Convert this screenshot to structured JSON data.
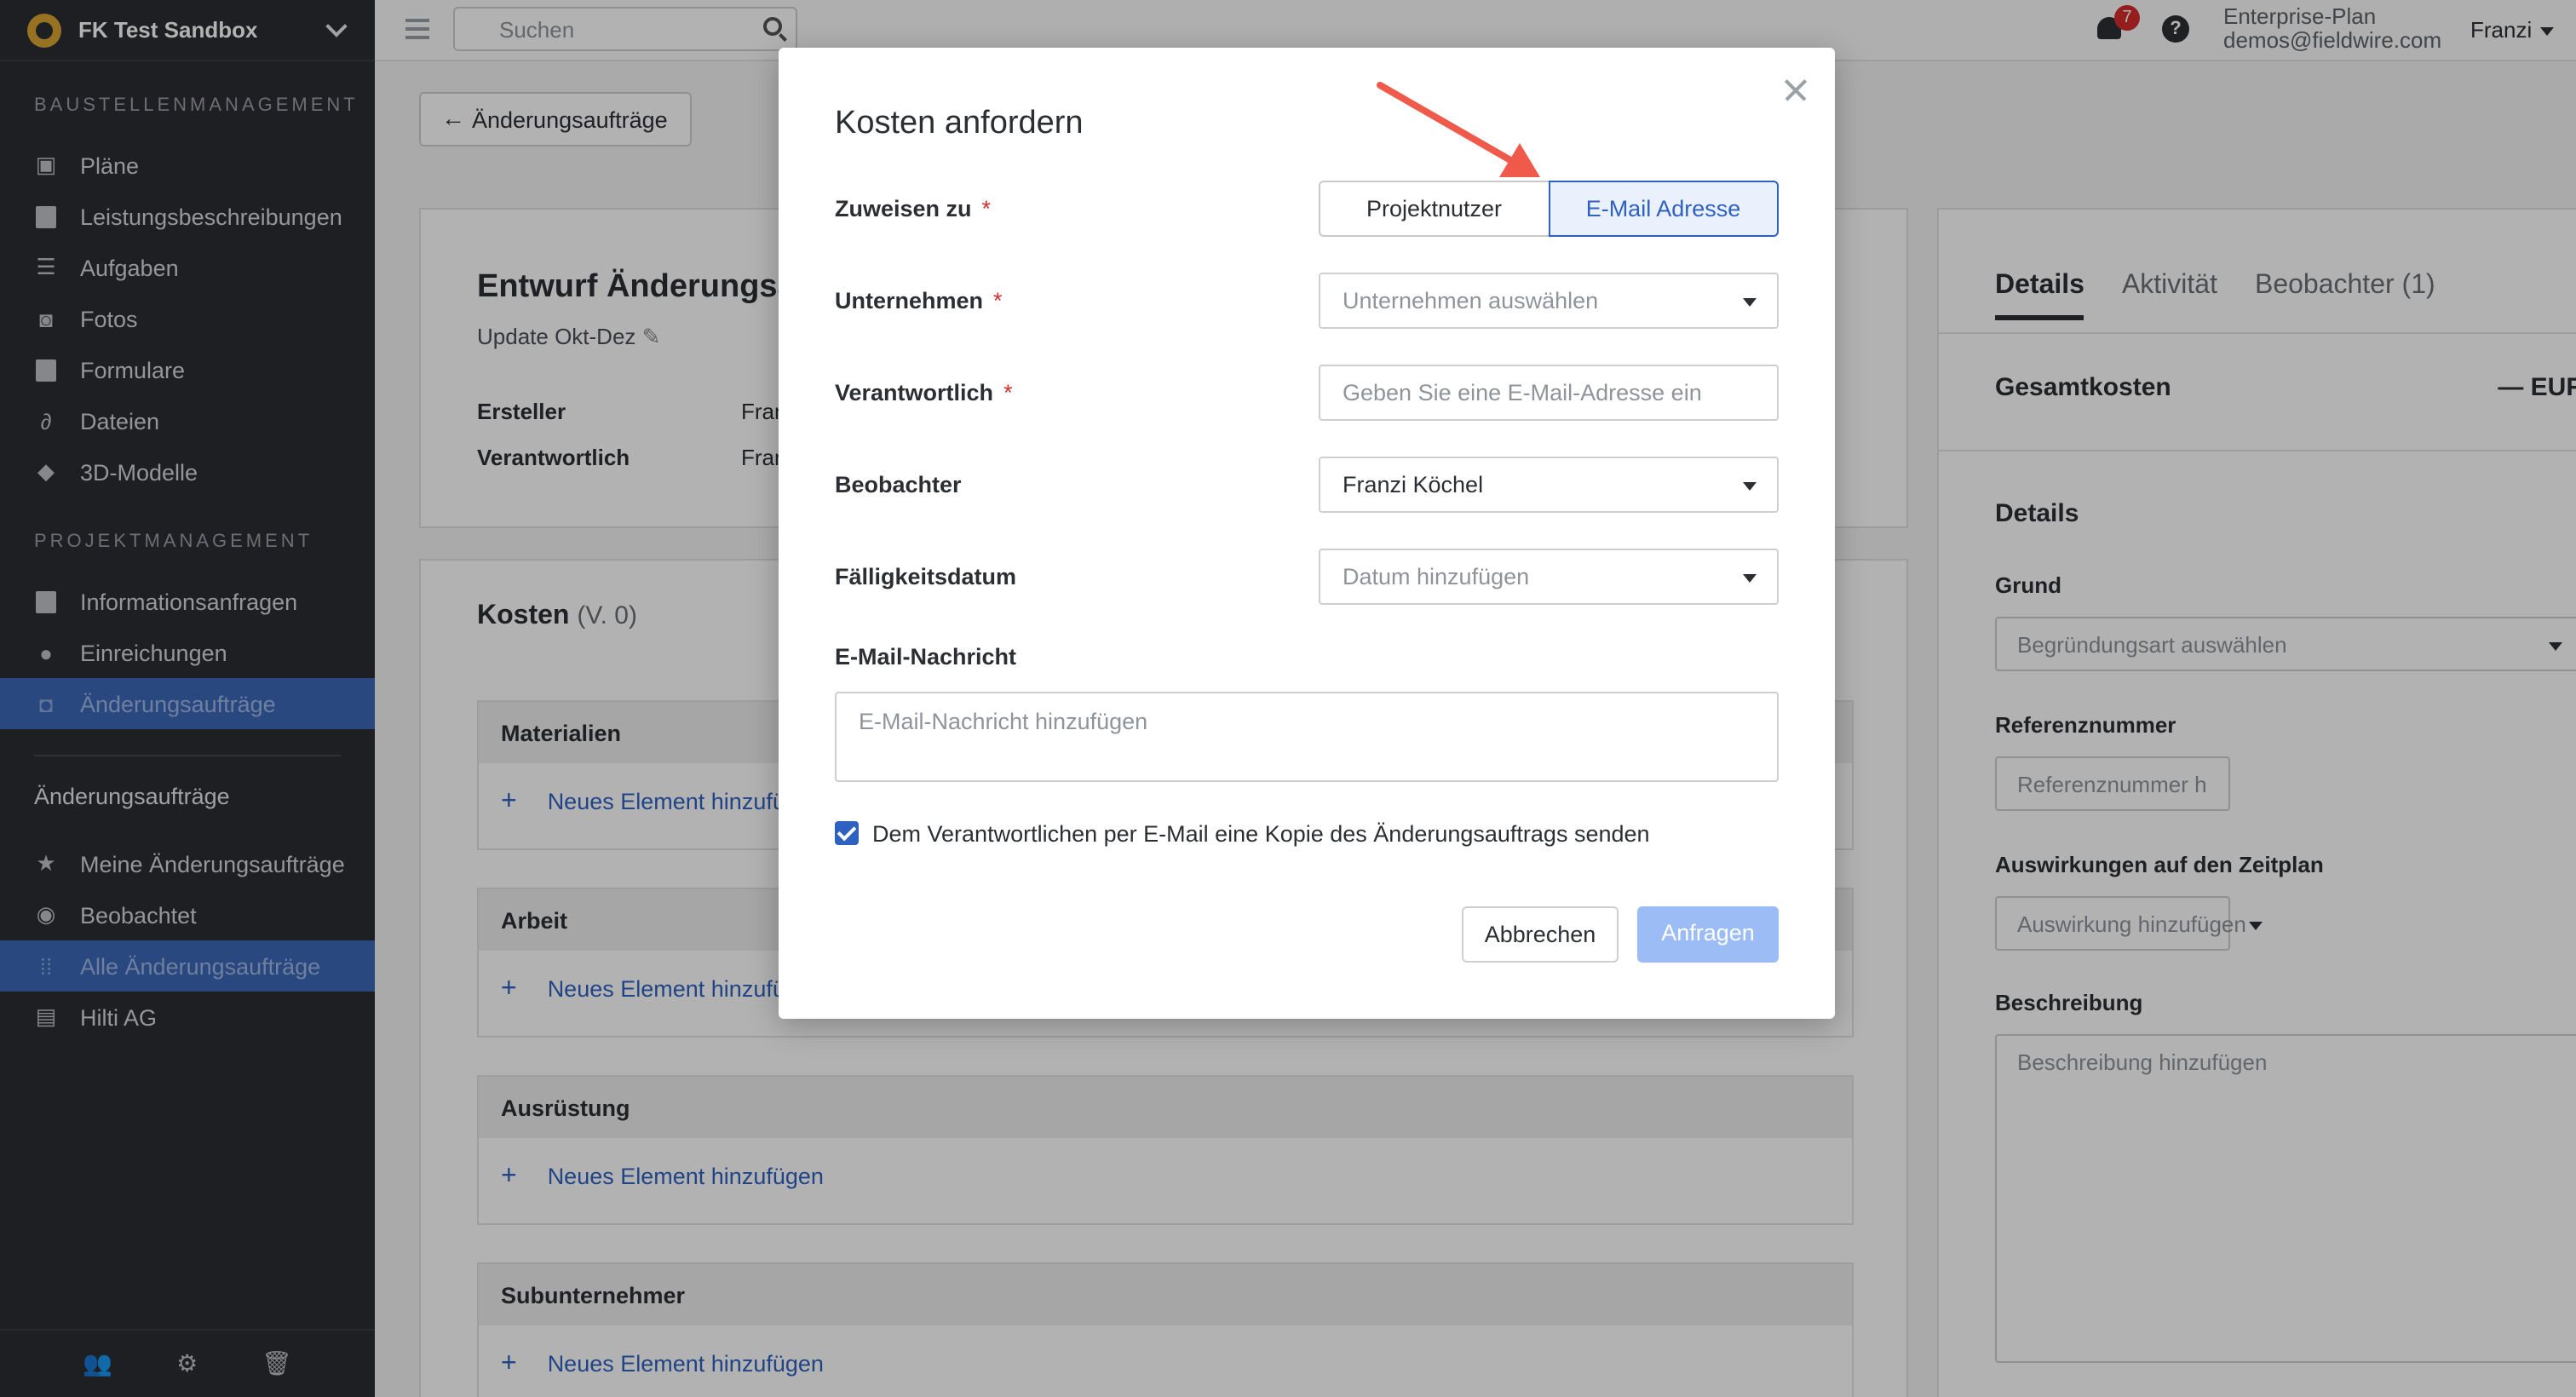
{
  "sidebar": {
    "project": "FK Test Sandbox",
    "sections": [
      {
        "title": "BAUSTELLENMANAGEMENT",
        "items": [
          {
            "label": "Pläne",
            "icon": "plans-icon"
          },
          {
            "label": "Leistungsbeschreibungen",
            "icon": "specs-icon"
          },
          {
            "label": "Aufgaben",
            "icon": "tasks-icon"
          },
          {
            "label": "Fotos",
            "icon": "camera-icon"
          },
          {
            "label": "Formulare",
            "icon": "forms-icon"
          },
          {
            "label": "Dateien",
            "icon": "paperclip-icon"
          },
          {
            "label": "3D-Modelle",
            "icon": "cube-icon"
          }
        ]
      },
      {
        "title": "PROJEKTMANAGEMENT",
        "items": [
          {
            "label": "Informationsanfragen",
            "icon": "info-icon"
          },
          {
            "label": "Einreichungen",
            "icon": "person-icon"
          },
          {
            "label": "Änderungsaufträge",
            "icon": "change-order-icon",
            "active": true
          }
        ]
      }
    ],
    "group_title": "Änderungsaufträge",
    "group_items": [
      {
        "label": "Meine Änderungsaufträge",
        "icon": "star-icon"
      },
      {
        "label": "Beobachtet",
        "icon": "eye-icon"
      },
      {
        "label": "Alle Änderungsaufträge",
        "icon": "grid-icon",
        "active": true
      },
      {
        "label": "Hilti AG",
        "icon": "briefcase-icon"
      }
    ]
  },
  "topbar": {
    "search_placeholder": "Suchen",
    "notifications": "7",
    "help": "?",
    "plan": "Enterprise-Plan",
    "email": "demos@fieldwire.com",
    "user": "Franzi"
  },
  "main": {
    "back_label": "Änderungsaufträge",
    "title": "Entwurf Änderungsau",
    "subtitle": "Update Okt-Dez",
    "rows": [
      {
        "label": "Ersteller",
        "value": "Franzi"
      },
      {
        "label": "Verantwortlich",
        "value": "Franzi"
      }
    ],
    "costs_title": "Kosten",
    "costs_version": "(V. 0)",
    "blocks": [
      {
        "title": "Materialien",
        "add": "Neues Element hinzufügen"
      },
      {
        "title": "Arbeit",
        "add": "Neues Element hinzufügen"
      },
      {
        "title": "Ausrüstung",
        "add": "Neues Element hinzufügen"
      },
      {
        "title": "Subunternehmer",
        "add": "Neues Element hinzufügen"
      }
    ]
  },
  "right_panel": {
    "tabs": [
      "Details",
      "Aktivität",
      "Beobachter (1)"
    ],
    "total_label": "Gesamtkosten",
    "total_value": "— EUR",
    "details_title": "Details",
    "grund_label": "Grund",
    "grund_placeholder": "Begründungsart auswählen",
    "ref_label": "Referenznummer",
    "ref_placeholder": "Referenznummer h",
    "impact_label": "Auswirkungen auf den Zeitplan",
    "impact_placeholder": "Auswirkung hinzufügen",
    "desc_label": "Beschreibung",
    "desc_placeholder": "Beschreibung hinzufügen"
  },
  "modal": {
    "title": "Kosten anfordern",
    "assign_label": "Zuweisen zu",
    "assign_options": [
      "Projektnutzer",
      "E-Mail Adresse"
    ],
    "company_label": "Unternehmen",
    "company_placeholder": "Unternehmen auswählen",
    "responsible_label": "Verantwortlich",
    "responsible_placeholder": "Geben Sie eine E-Mail-Adresse ein",
    "watcher_label": "Beobachter",
    "watcher_value": "Franzi Köchel",
    "due_label": "Fälligkeitsdatum",
    "due_placeholder": "Datum hinzufügen",
    "message_label": "E-Mail-Nachricht",
    "message_placeholder": "E-Mail-Nachricht hinzufügen",
    "checkbox_label": "Dem Verantwortlichen per E-Mail eine Kopie des Änderungsauftrags senden",
    "cancel": "Abbrechen",
    "submit": "Anfragen",
    "required_mark": "*"
  },
  "colors": {
    "accent": "#2f62c0",
    "sidebar": "#2a2d31",
    "annotation_arrow": "#ef5a4a"
  }
}
